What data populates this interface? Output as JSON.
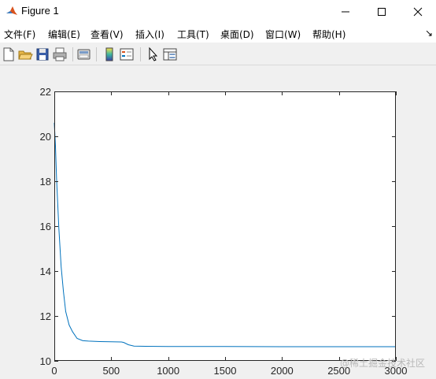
{
  "window": {
    "title": "Figure 1"
  },
  "menu": {
    "items": [
      "文件(F)",
      "编辑(E)",
      "查看(V)",
      "插入(I)",
      "工具(T)",
      "桌面(D)",
      "窗口(W)",
      "帮助(H)"
    ],
    "overflow_arrow": "↘"
  },
  "toolbar": {
    "icons": [
      "new-figure-icon",
      "open-file-icon",
      "save-icon",
      "print-icon",
      "print-preview-icon",
      "colorbar-icon",
      "legend-icon",
      "pointer-icon",
      "property-editor-icon"
    ]
  },
  "colors": {
    "line": "#0072bd",
    "axes_bg": "#ffffff",
    "figure_bg": "#f0f0f0"
  },
  "watermark": "@稀土掘金技术社区",
  "chart_data": {
    "type": "line",
    "title": "",
    "xlabel": "",
    "ylabel": "",
    "xlim": [
      0,
      3000
    ],
    "ylim": [
      10,
      22
    ],
    "xticks": [
      "0",
      "500",
      "1000",
      "1500",
      "2000",
      "2500",
      "3000"
    ],
    "yticks": [
      "10",
      "12",
      "14",
      "16",
      "18",
      "20",
      "22"
    ],
    "grid": false,
    "series": [
      {
        "x": [
          0,
          10,
          20,
          40,
          60,
          80,
          100,
          130,
          160,
          200,
          250,
          300,
          400,
          500,
          590,
          610,
          650,
          700,
          800,
          1000,
          1500,
          2000,
          2500,
          3000
        ],
        "y": [
          20.6,
          19.6,
          18.1,
          15.9,
          14.2,
          13.1,
          12.2,
          11.6,
          11.3,
          11.0,
          10.9,
          10.88,
          10.86,
          10.85,
          10.84,
          10.82,
          10.72,
          10.66,
          10.65,
          10.64,
          10.64,
          10.63,
          10.63,
          10.63
        ]
      }
    ]
  }
}
